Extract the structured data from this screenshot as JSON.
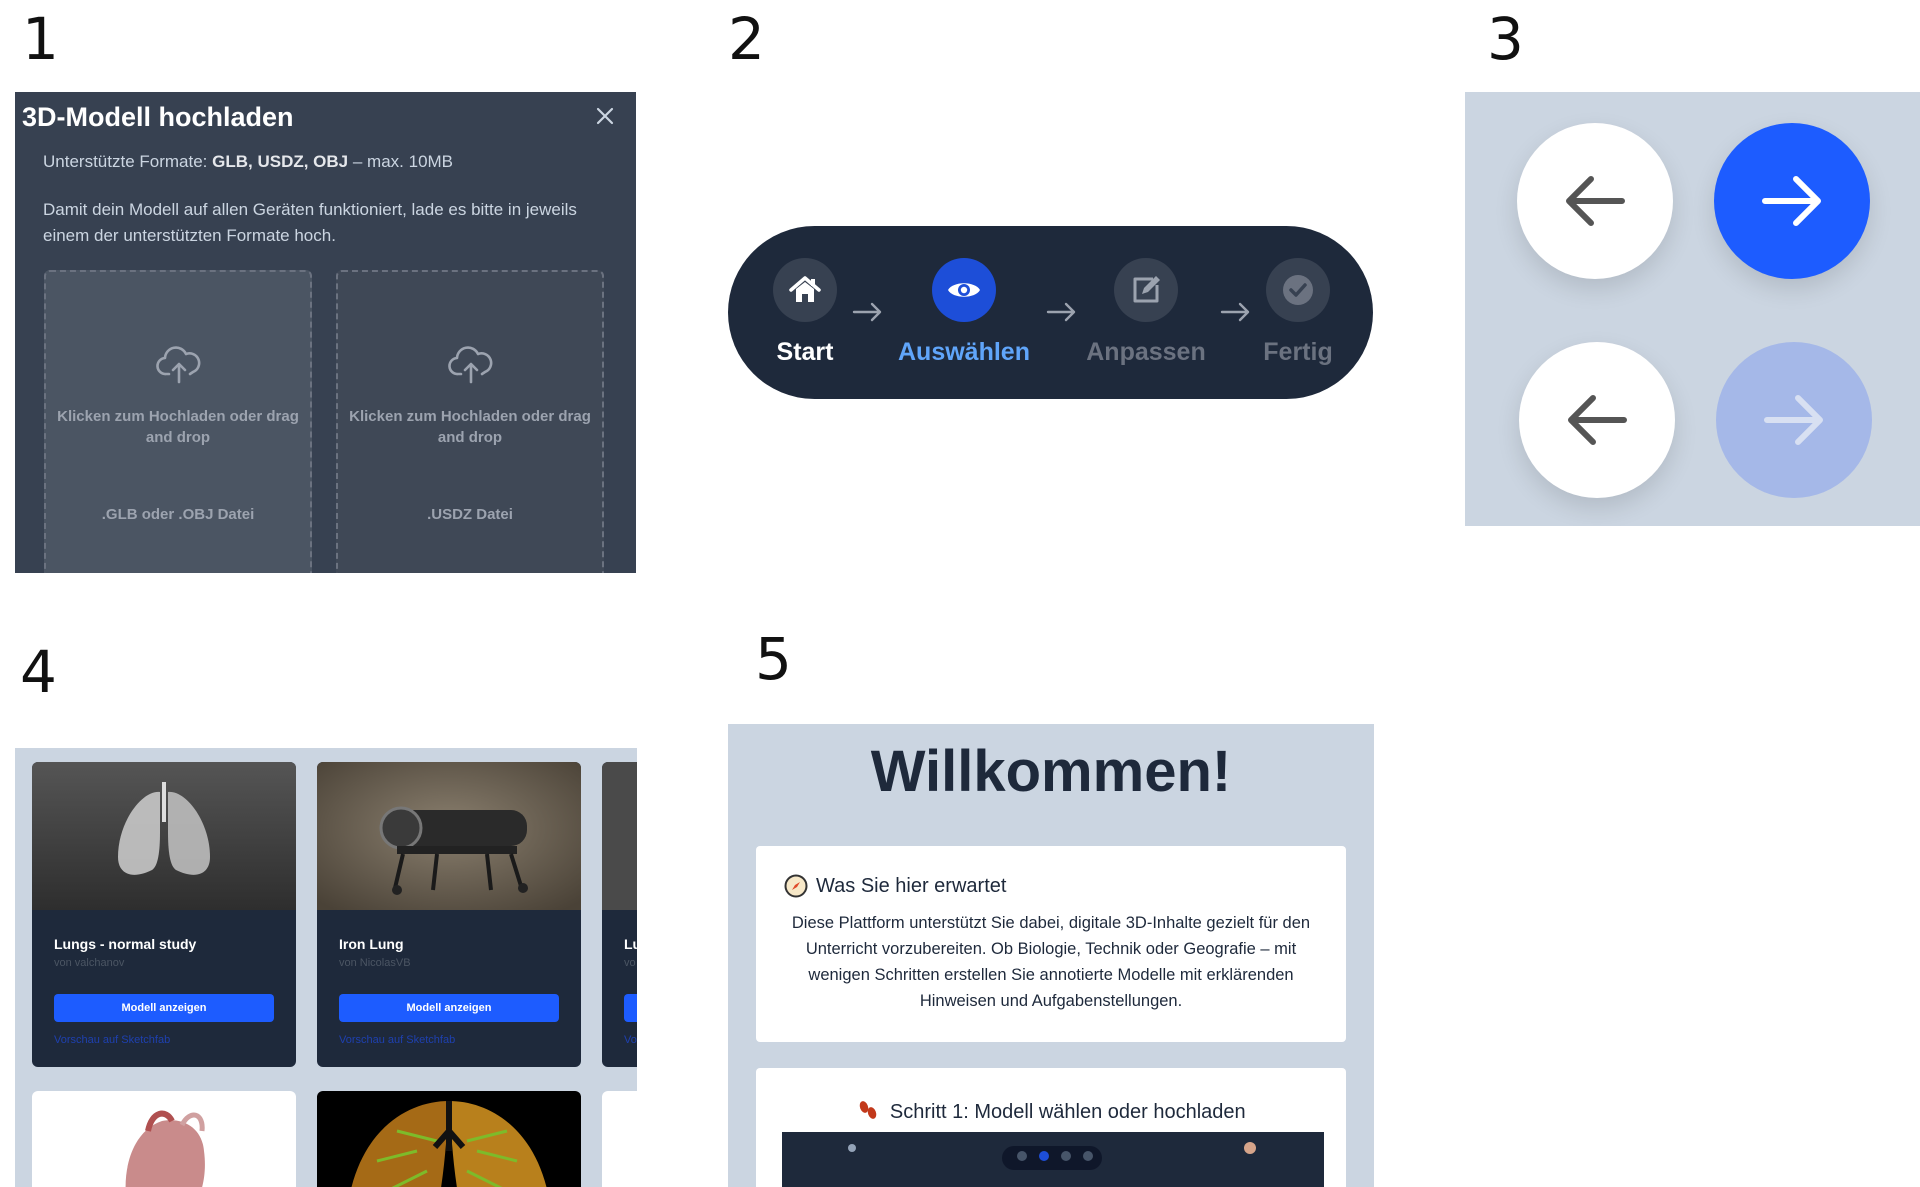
{
  "labels": [
    "1",
    "2",
    "3",
    "4",
    "5"
  ],
  "upload_dialog": {
    "title": "3D-Modell hochladen",
    "formats_prefix": "Unterstützte Formate:",
    "formats_bold": "GLB, USDZ, OBJ",
    "formats_suffix": "– max. 10MB",
    "description": "Damit dein Modell auf allen Geräten funktioniert, lade es bitte in jeweils einem der unterstützten Formate hoch.",
    "dropzones": [
      {
        "text": "Klicken zum Hochladen oder drag and drop",
        "type": ".GLB oder .OBJ Datei"
      },
      {
        "text": "Klicken zum Hochladen oder drag and drop",
        "type": ".USDZ Datei"
      }
    ],
    "colors": {
      "background": "#374151",
      "dropzone": "#4b5563"
    }
  },
  "stepper": {
    "steps": [
      {
        "label": "Start",
        "icon": "home-icon",
        "state": "done"
      },
      {
        "label": "Auswählen",
        "icon": "eye-icon",
        "state": "active"
      },
      {
        "label": "Anpassen",
        "icon": "edit-icon",
        "state": "pending"
      },
      {
        "label": "Fertig",
        "icon": "check-circle-icon",
        "state": "pending"
      }
    ],
    "colors": {
      "background": "#1e293b",
      "active": "#1d4ed8",
      "active_label": "#60a5fa"
    }
  },
  "nav_buttons": {
    "rows": [
      {
        "prev": {
          "icon": "arrow-left-icon",
          "enabled": true
        },
        "next": {
          "icon": "arrow-right-icon",
          "enabled": true
        }
      },
      {
        "prev": {
          "icon": "arrow-left-icon",
          "enabled": true
        },
        "next": {
          "icon": "arrow-right-icon",
          "enabled": false
        }
      }
    ],
    "colors": {
      "primary": "#1d5cff",
      "disabled": "#a5b8e8"
    }
  },
  "model_gallery": {
    "cards": [
      {
        "title": "Lungs - normal study",
        "author": "von valchanov",
        "button": "Modell anzeigen",
        "link": "Vorschau auf Sketchfab"
      },
      {
        "title": "Iron Lung",
        "author": "von NicolasVB",
        "button": "Modell anzeigen",
        "link": "Vorschau auf Sketchfab"
      },
      {
        "title": "Lu",
        "author": "vo",
        "button": "",
        "link": "Vo"
      }
    ]
  },
  "welcome": {
    "title": "Willkommen!",
    "section1_heading": "Was Sie hier erwartet",
    "section1_text": "Diese Plattform unterstützt Sie dabei, digitale 3D-Inhalte gezielt für den Unterricht vorzubereiten. Ob Biologie, Technik oder Geografie – mit wenigen Schritten erstellen Sie annotierte Modelle mit erklärenden Hinweisen und Aufgabenstellungen.",
    "section2_heading": "Schritt 1: Modell wählen oder hochladen"
  }
}
